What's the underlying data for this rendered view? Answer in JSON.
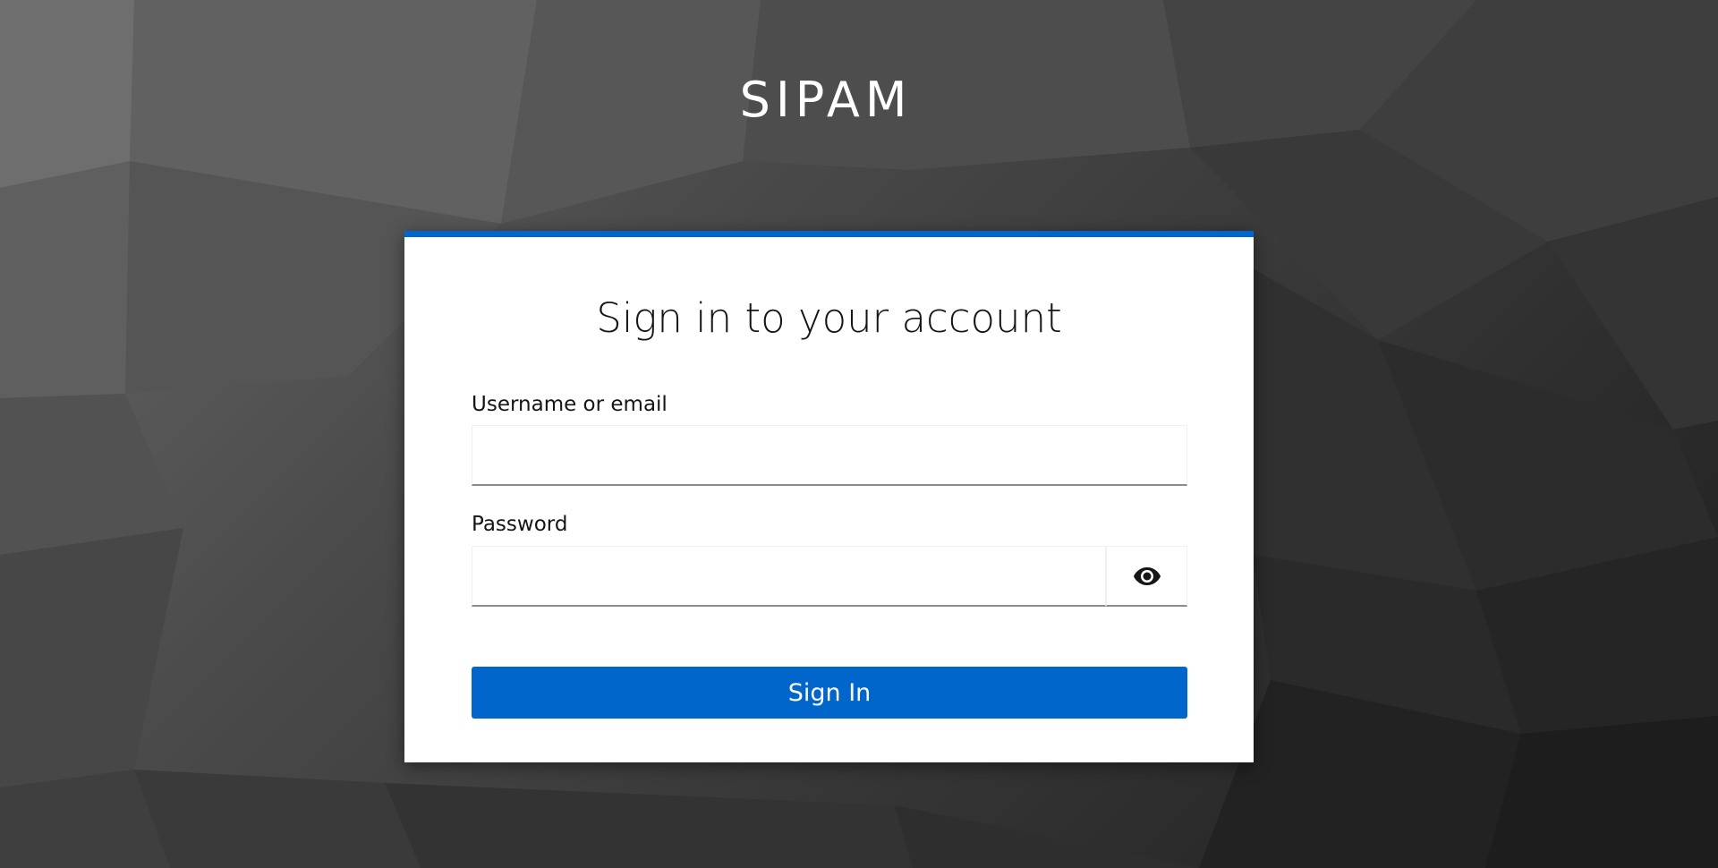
{
  "header": {
    "realm_name": "SIPAM"
  },
  "login": {
    "title": "Sign in to your account",
    "username": {
      "label": "Username or email",
      "value": ""
    },
    "password": {
      "label": "Password",
      "value": "",
      "toggle_icon": "eye-icon"
    },
    "submit_label": "Sign In"
  },
  "colors": {
    "accent": "#0066cc",
    "card_background": "#ffffff",
    "page_background": "#3a3a3a"
  }
}
